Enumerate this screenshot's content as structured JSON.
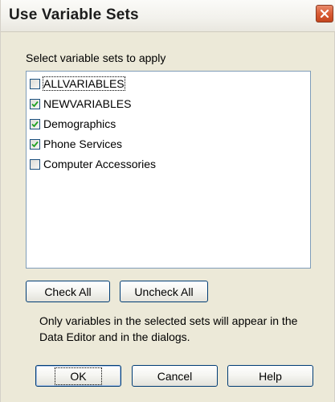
{
  "window": {
    "title": "Use Variable Sets",
    "close_icon": "close-icon"
  },
  "prompt": "Select variable sets to apply",
  "variable_sets": [
    {
      "label": "ALLVARIABLES",
      "checked": false,
      "focused": true
    },
    {
      "label": "NEWVARIABLES",
      "checked": true,
      "focused": false
    },
    {
      "label": "Demographics",
      "checked": true,
      "focused": false
    },
    {
      "label": "Phone Services",
      "checked": true,
      "focused": false
    },
    {
      "label": "Computer Accessories",
      "checked": false,
      "focused": false
    }
  ],
  "buttons": {
    "check_all": "Check All",
    "uncheck_all": "Uncheck All",
    "ok": "OK",
    "cancel": "Cancel",
    "help": "Help"
  },
  "info_text": "Only variables in the selected sets will appear in the Data Editor and in the dialogs.",
  "colors": {
    "dialog_bg": "#ece9d8",
    "checkmark": "#21a121",
    "close_button": "#d95b34",
    "list_border": "#7f9db9"
  }
}
